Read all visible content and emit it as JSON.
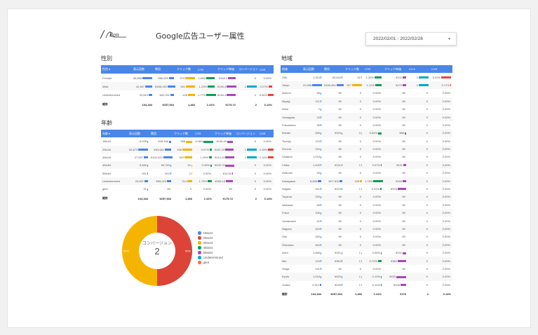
{
  "header": {
    "logo_text": "Bon",
    "title": "Google広告ユーザー属性",
    "date_range": "2022/02/01 - 2022/02/28",
    "date_chevron": "▾"
  },
  "colors": {
    "header_blue": "#4a86e8",
    "bar_blue": "#4a86e8",
    "bar_orange": "#f4b400",
    "bar_green": "#0f9d58",
    "bar_purple": "#ab47bc",
    "bar_teal": "#00acc1",
    "bar_red": "#e8453c",
    "donut_red": "#db4437",
    "donut_yellow": "#f4b400"
  },
  "gender": {
    "title": "性別",
    "columns": [
      "性別 ▾",
      "表示回数",
      "費用",
      "クリック数",
      "CTR",
      "クリック単価",
      "コンバージョン",
      "CVR"
    ],
    "rows": [
      [
        "Female",
        "58,808",
        "¥86,829",
        "573",
        "1.46%",
        "¥148.2",
        "0",
        "0.00%"
      ],
      [
        "Male",
        "42,467",
        "¥168,155",
        "541",
        "1.23%",
        "¥196.4",
        "1",
        "0.27%"
      ],
      [
        "Undetermined",
        "22,819",
        "¥62,091",
        "426",
        "1.77%",
        "¥184.4",
        "0",
        "0.82%"
      ]
    ],
    "total": [
      "総計",
      "104,184",
      "¥257,934",
      "1,466",
      "1.41%",
      "¥175.72",
      "2",
      "0.14%"
    ]
  },
  "age": {
    "title": "年齢",
    "columns": [
      "年齢 ▾",
      "表示回数",
      "費用",
      "クリック数",
      "CTR",
      "クリック単価",
      "コンバージョン",
      "CVR"
    ],
    "rows": [
      [
        "18to24",
        "6,028",
        "¥28,156",
        "288",
        "4.08%",
        "¥136.45",
        "0",
        "0.00%"
      ],
      [
        "25to34",
        "62,673",
        "¥93,662",
        "436",
        "0.97%",
        "¥187.29",
        "1",
        "0.33%"
      ],
      [
        "35to44",
        "27,697",
        "¥142,023",
        "343",
        "1.26%",
        "¥214.43",
        "1",
        "0.34%"
      ],
      [
        "45to54",
        "6,686",
        "¥4,763",
        "31",
        "0.45%",
        "¥225.79",
        "0",
        "0.00%"
      ],
      [
        "55to64",
        "931",
        "¥10",
        "1",
        "0.00%",
        "¥14.63",
        "0",
        "0.00%"
      ],
      [
        "Undetermined",
        "23,697",
        "¥65,023",
        "214",
        "1.73%",
        "¥155.13",
        "0",
        "0.00%"
      ],
      [
        "gte4",
        "31",
        "¥0",
        "0",
        "0.00%",
        "¥0",
        "0",
        "0.00%"
      ]
    ],
    "total": [
      "総計",
      "104,184",
      "¥257,934",
      "1,466",
      "1.41%",
      "¥175.72",
      "2",
      "0.14%"
    ]
  },
  "donut": {
    "center_label": "コンバージョン",
    "center_value": "2",
    "legend": [
      "18to24",
      "25to34",
      "35to44",
      "45to54",
      "55to64",
      "Undetermined",
      "gte4"
    ],
    "legend_colors": [
      "#4a86e8",
      "#db4437",
      "#f4b400",
      "#0f9d58",
      "#ab47bc",
      "#00acc1",
      "#ff7043"
    ],
    "slices": [
      {
        "name": "25to34",
        "value": 50,
        "label": "50%"
      },
      {
        "name": "35to44",
        "value": 50,
        "label": "50%"
      }
    ]
  },
  "region": {
    "title": "地域",
    "columns": [
      "地域",
      "表示回数",
      "費用",
      "クリック数",
      "CTR",
      "クリック単価",
      "CV ▾",
      "CVR"
    ],
    "rows": [
      [
        "Gifu",
        "1,324",
        "¥3,634",
        "52",
        "1.30%",
        "¥142",
        "1",
        "5.00%"
      ],
      [
        "Tokyo",
        "22,656",
        "¥105,364",
        "917",
        "1.12%",
        "¥170",
        "1",
        "0.17%"
      ],
      [
        "Aomori",
        "58",
        "¥0",
        "0",
        "0.00%",
        "¥0",
        "0",
        "0.00%"
      ],
      [
        "Miyagi",
        "121",
        "¥0",
        "0",
        "0.00%",
        "¥0",
        "0",
        "0.00%"
      ],
      [
        "Akita",
        "2",
        "¥0",
        "0",
        "0.00%",
        "¥0",
        "0",
        "0.00%"
      ],
      [
        "Yamagata",
        "43",
        "¥0",
        "0",
        "0.00%",
        "¥0",
        "0",
        "0.00%"
      ],
      [
        "Fukushima",
        "36",
        "¥0",
        "0",
        "0.00%",
        "¥0",
        "0",
        "0.00%"
      ],
      [
        "Ibaraki",
        "466",
        "¥204",
        "3",
        "0.64%",
        "¥68",
        "0",
        "0.00%"
      ],
      [
        "Tochigi",
        "124",
        "¥0",
        "0",
        "0.00%",
        "¥0",
        "0",
        "0.00%"
      ],
      [
        "Gunma",
        "234",
        "¥0",
        "0",
        "0.00%",
        "¥0",
        "0",
        "0.00%"
      ],
      [
        "Saitama",
        "1,018",
        "¥0",
        "0",
        "0.00%",
        "¥0",
        "0",
        "0.00%"
      ],
      [
        "Chiba",
        "1,425",
        "¥131",
        "1",
        "0.07%",
        "¥131",
        "0",
        "0.00%"
      ],
      [
        "Asikonis",
        "33",
        "¥0",
        "0",
        "0.00%",
        "¥0",
        "0",
        "0.00%"
      ],
      [
        "Kanagawa",
        "8,836",
        "¥27,304",
        "165",
        "1.79%",
        "¥165",
        "0",
        "0.00%"
      ],
      [
        "Niigata",
        "321",
        "¥375",
        "1",
        "0.31%",
        "¥375",
        "0",
        "0.00%"
      ],
      [
        "Toyama",
        "226",
        "¥0",
        "0",
        "0.00%",
        "¥0",
        "0",
        "0.00%"
      ],
      [
        "Ishikawa",
        "58",
        "¥0",
        "0",
        "0.00%",
        "¥0",
        "0",
        "0.00%"
      ],
      [
        "Fukui",
        "106",
        "¥0",
        "0",
        "0.00%",
        "¥0",
        "0",
        "0.00%"
      ],
      [
        "Yamanashi",
        "42",
        "¥0",
        "0",
        "0.00%",
        "¥0",
        "0",
        "0.00%"
      ],
      [
        "Nagano",
        "204",
        "¥0",
        "0",
        "0.00%",
        "¥0",
        "0",
        "0.00%"
      ],
      [
        "Gifu",
        "250",
        "¥0",
        "0",
        "0.00%",
        "¥0",
        "0",
        "0.00%"
      ],
      [
        "Shizuoka",
        "463",
        "¥0",
        "0",
        "0.00%",
        "¥0",
        "0",
        "0.00%"
      ],
      [
        "Aichi",
        "1,666",
        "¥151",
        "1",
        "0.06%",
        "¥151",
        "0",
        "0.00%"
      ],
      [
        "Mie",
        "143",
        "¥362",
        "1",
        "0.70%",
        "¥362",
        "0",
        "0.00%"
      ],
      [
        "Shiga",
        "141",
        "¥0",
        "0",
        "0.00%",
        "¥0",
        "0",
        "0.00%"
      ],
      [
        "Kyoto",
        "1,018",
        "¥433",
        "1",
        "0.10%",
        "¥433",
        "0",
        "0.00%"
      ],
      [
        "Osaka",
        "2,514",
        "¥248",
        "1",
        "0.10%",
        "¥248",
        "0",
        "0.00%"
      ]
    ],
    "total": [
      "総計",
      "104,184",
      "¥257,934",
      "1,466",
      "1.41%",
      "¥176",
      "2",
      "0.14%"
    ]
  }
}
